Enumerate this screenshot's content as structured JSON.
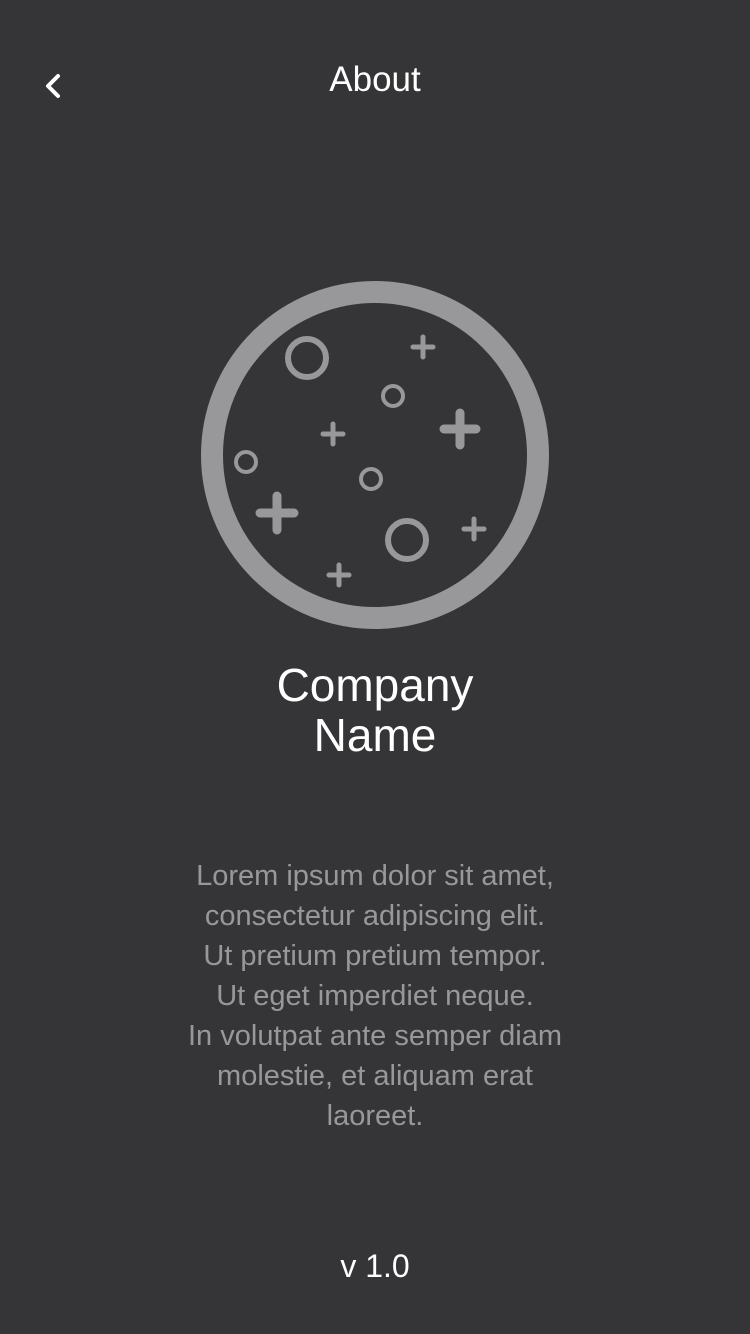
{
  "nav": {
    "back_icon": "chevron-left-icon",
    "title": "About"
  },
  "logo": {
    "icon": "planet-crater-icon",
    "color": "#98989b"
  },
  "company": {
    "name_line_1": "Company",
    "name_line_2": "Name"
  },
  "description": {
    "lines": [
      "Lorem ipsum dolor sit amet,",
      "consectetur adipiscing elit.",
      "Ut pretium pretium tempor.",
      "Ut eget imperdiet neque.",
      "In volutpat ante semper diam",
      "molestie, et aliquam erat",
      "laoreet."
    ]
  },
  "footer": {
    "version": "v 1.0"
  },
  "colors": {
    "background": "#353537",
    "primary_text": "#ffffff",
    "secondary_text": "#98989b"
  }
}
